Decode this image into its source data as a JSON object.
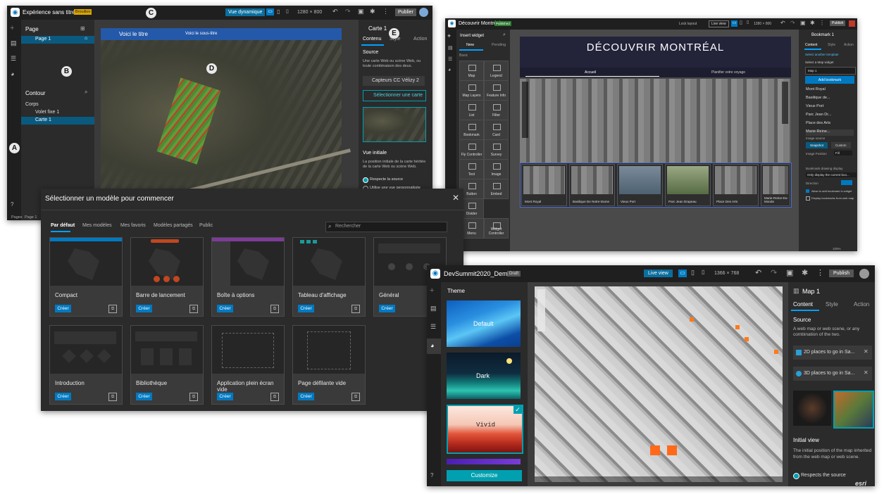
{
  "win1": {
    "title": "Expérience sans titre 1",
    "status": "Brouillon",
    "live_view": "Vue dynamique",
    "resolution": "1280 × 800",
    "publish": "Publier",
    "page_panel_title": "Page",
    "page_item": "Page 1",
    "outline_title": "Contour",
    "outline_body": "Corps",
    "outline_items": [
      "Volet fixe 1",
      "Carte 1"
    ],
    "map_title": "Voici le titre",
    "map_subtitle": "Voici le sous-titre",
    "right_panel_title": "Carte 1",
    "tabs": [
      "Contenu",
      "Style",
      "Action"
    ],
    "source_title": "Source",
    "source_desc": "Une carte Web ou scène Web, ou toute combinaison des deux.",
    "source_item": "Capteurs CC Vélizy 2",
    "select_map": "Sélectionner une carte",
    "initial_view_title": "Vue initiale",
    "initial_view_desc": "La position initiale de la carte héritée de la carte Web ou scène Web.",
    "radio1": "Respecte la source",
    "radio2": "Utilise une vue personnalisée",
    "footer": [
      "Pages",
      "Page 1"
    ],
    "badges": [
      "A",
      "B",
      "C",
      "D",
      "E"
    ]
  },
  "dialog": {
    "title": "Sélectionner un modèle pour commencer",
    "tabs": [
      "Par défaut",
      "Mes modèles",
      "Mes favoris",
      "Modèles partagés",
      "Public"
    ],
    "search_placeholder": "Rechercher",
    "create_label": "Créer",
    "templates": [
      "Compact",
      "Barre de lancement",
      "Boîte à options",
      "Tableau d'affichage",
      "Général",
      "Introduction",
      "Bibliothèque",
      "Application plein écran vide",
      "Page défilante vide"
    ]
  },
  "win2": {
    "title": "Découvrir Montréal",
    "status": "Published",
    "lock_layout": "Lock layout",
    "live_view": "Live view",
    "resolution": "1280 × 800",
    "publish": "Publish",
    "insert_title": "Insert widget",
    "insert_tabs": [
      "New",
      "Pending"
    ],
    "basic_label": "Basic",
    "widgets": [
      "Map",
      "Legend",
      "Map Layers",
      "Feature Info",
      "List",
      "Filter",
      "Bookmark",
      "Card",
      "Fly Controller",
      "Survey",
      "Text",
      "Image",
      "Button",
      "Embed",
      "Divider",
      "Menu",
      "Widget Controller"
    ],
    "page_title": "DÉCOUVRIR MONTRÉAL",
    "page_nav": [
      "Accueil",
      "Planifier votre voyage"
    ],
    "strip": [
      "Mont Royal",
      "Basilique De Notre-Dame",
      "Vieux Port",
      "Parc Jean Drapeau",
      "Place Des Arts",
      "Marie-Reine-Du-Monde"
    ],
    "right_title": "Bookmark 1",
    "right_tabs": [
      "Content",
      "Style",
      "Action"
    ],
    "select_template": "Select another template",
    "select_map_widget": "Select a Map widget",
    "map_value": "Map 1",
    "add_bookmark": "Add bookmark",
    "bookmarks": [
      "Mont Royal",
      "Basilique de...",
      "Vieux Port",
      "Parc Jean Dr...",
      "Place des Arts",
      "Marie-Reine..."
    ],
    "image_source": "Image source",
    "image_btns": [
      "Snapshot",
      "Custom"
    ],
    "image_position": "Image Position",
    "image_position_value": "Fill",
    "drawing_display": "Bookmark drawing display",
    "drawing_value": "Only display the current boo...",
    "direction": "Direction",
    "check1": "Allow to add bookmark in widget",
    "check2": "Display bookmarks from web map",
    "zoom": "100%"
  },
  "win3": {
    "title": "DevSummit2020_Demo",
    "status": "Draft",
    "live_view": "Live view",
    "resolution": "1366 × 768",
    "publish": "Publish",
    "theme_title": "Theme",
    "themes": [
      "Default",
      "Dark",
      "Vivid"
    ],
    "customize": "Customize",
    "right_title": "Map 1",
    "tabs": [
      "Content",
      "Style",
      "Action"
    ],
    "source_title": "Source",
    "source_desc": "A web map or web scene, or any combination of the two.",
    "sources": [
      "2D places to go in Sa...",
      "3D places to go in Sa..."
    ],
    "initial_view_title": "Initial view",
    "initial_view_desc": "The initial position of the map inherited from the web map or web scene.",
    "radio1": "Respects the source",
    "esri": "esri"
  },
  "colors": {
    "accent": "#0079c1",
    "teal": "#00a0b0",
    "dark": "#2b2b2b"
  }
}
